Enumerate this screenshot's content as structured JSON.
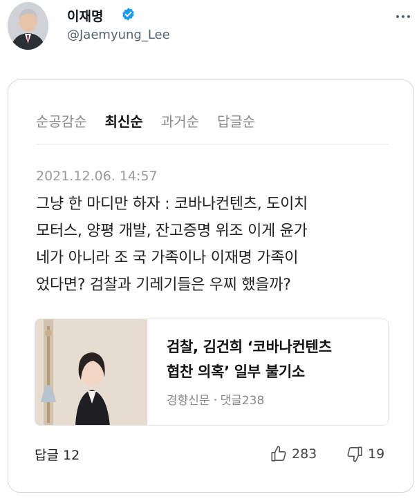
{
  "tweet": {
    "author_name": "이재명",
    "handle": "@Jaemyung_Lee"
  },
  "card": {
    "tabs": [
      {
        "label": "순공감순",
        "active": false
      },
      {
        "label": "최신순",
        "active": true
      },
      {
        "label": "과거순",
        "active": false
      },
      {
        "label": "답글순",
        "active": false
      }
    ],
    "comment": {
      "timestamp": "2021.12.06. 14:57",
      "lines": [
        "그냥 한 마디만 하자 : 코바나컨텐츠, 도이치",
        "모터스, 양평 개발, 잔고증명 위조 이게 윤가",
        "네가 아니라 조 국 가족이나 이재명 가족이",
        "었다면? 검찰과 기레기들은 우찌 했을까?"
      ]
    },
    "article": {
      "title_line1": "검찰, 김건희 ‘코바나컨텐츠",
      "title_line2": "협찬 의혹’ 일부 불기소",
      "source": "경향신문",
      "comments": "댓글238"
    },
    "footer": {
      "reply_label": "답글 12",
      "likes": "283",
      "dislikes": "19"
    }
  },
  "colors": {
    "verified": "#1d9bf0",
    "muted": "#536471",
    "border": "#cfd9de"
  },
  "icons": [
    "verified-badge-icon",
    "more-options-icon",
    "thumbs-up-icon",
    "thumbs-down-icon"
  ]
}
